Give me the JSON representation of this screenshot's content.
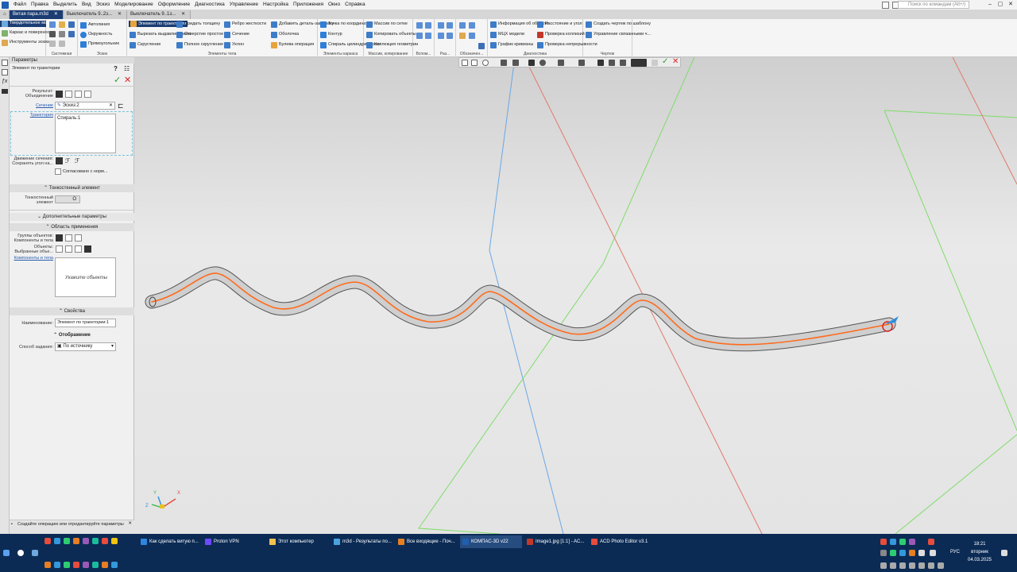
{
  "menubar": {
    "items": [
      "Файл",
      "Правка",
      "Выделить",
      "Вид",
      "Эскиз",
      "Моделирование",
      "Оформление",
      "Диагностика",
      "Управление",
      "Настройка",
      "Приложения",
      "Окно",
      "Справка"
    ],
    "search_placeholder": "Поиск по командам (Alt+/)"
  },
  "tabs": [
    {
      "label": "Витая пара.m3d",
      "active": true
    },
    {
      "label": "Выключатель 9..2з...",
      "active": false
    },
    {
      "label": "Выключатель 9..1з...",
      "active": false
    }
  ],
  "ribbon": {
    "modes": [
      "Твердотельное моделирование",
      "Каркас и поверхности",
      "Инструменты эскиза"
    ],
    "system_group": "Системная",
    "sketch": {
      "items": [
        "Автолиния",
        "Окружность",
        "Прямоугольник"
      ],
      "label": "Эскиз"
    },
    "body": {
      "items": [
        "Элемент по траектории",
        "Вырезать выдавливанием",
        "Скругление",
        "Придать толщину",
        "Отверстие простое",
        "Полное скругление",
        "Ребро жесткости",
        "Сечение",
        "Уклон",
        "Добавить деталь-заготовку",
        "Оболочка",
        "Булева операция"
      ],
      "label": "Элементы тела"
    },
    "frame": {
      "items": [
        "Точка по координатам",
        "Контур",
        "Спираль цилиндрическая"
      ],
      "label": "Элементы каркаса"
    },
    "array": {
      "items": [
        "Массив по сетке",
        "Копировать объекты",
        "Коллекция геометрии"
      ],
      "label": "Массив, копирование"
    },
    "aux_label": "Вспом...",
    "dim_label": "Раз...",
    "marks_label": "Обозначен...",
    "diag": {
      "items": [
        "Информация об объекте",
        "МЦХ модели",
        "График кривизны",
        "Расстояние и угол",
        "Проверка коллизий",
        "Проверка непрерывности"
      ],
      "label": "Диагностика"
    },
    "drawing": {
      "items": [
        "Создать чертеж по шаблону",
        "Управление связанными ч..."
      ],
      "label": "Чертеж"
    }
  },
  "panel": {
    "title": "Параметры",
    "subtitle": "Элемент по траектории",
    "result_label": "Результат: Объединение",
    "section_label": "Сечение",
    "section_value": "Эскиз:2",
    "trajectory_label": "Траектория",
    "trajectory_value": "Спираль:1",
    "motion_label": "Движение сечения: Сохранять угол на...",
    "normal_checkbox": "Согласовано с норм...",
    "thin_section": "Тонкостенный элемент",
    "thin_label": "Тонкостенный элемент",
    "thin_toggle": "О",
    "extra_section": "Дополнительные параметры",
    "area_section": "Область применения",
    "groups_label": "Группы объектов: Компоненты и тела",
    "objects_label": "Объекты: Выбранные объе...",
    "components_link": "Компоненты и тела",
    "objects_placeholder": "Укажите объекты",
    "props_section": "Свойства",
    "name_label": "Наименование:",
    "name_value": "Элемент по траектории:1",
    "display_section": "Отображение",
    "method_label": "Способ задания:",
    "method_value": "По источнику",
    "hint": "Создайте операцию или отредактируйте параметры"
  },
  "triad": {
    "x": "X",
    "y": "Y",
    "z": "Z"
  },
  "taskbar": {
    "items": [
      {
        "label": "Как сделать витую п...",
        "color": "#2e86de"
      },
      {
        "label": "Proton VPN",
        "color": "#6d4aff"
      },
      {
        "label": "Этот компьютер",
        "color": "#f2c14e"
      },
      {
        "label": "m3d - Результаты по...",
        "color": "#4aa3df"
      },
      {
        "label": "Все входящие - Поч...",
        "color": "#e67e22"
      },
      {
        "label": "КОМПАС-3D v22",
        "color": "#1f5fb0"
      },
      {
        "label": "Image1.jpg [1:1] - AC...",
        "color": "#c0392b"
      },
      {
        "label": "ACD Photo Editor v3.1",
        "color": "#e74c3c"
      }
    ],
    "lang": "РУС",
    "time": "18:21",
    "day": "вторник",
    "date": "04.03.2025"
  },
  "colors": {
    "accent": "#1b3d73",
    "curve": "#ff6a1a",
    "blue_axis": "#6aa6e6",
    "green_axis": "#7fdc6a",
    "red_axis": "#e07a6a",
    "taskbar": "#0b2b55"
  }
}
